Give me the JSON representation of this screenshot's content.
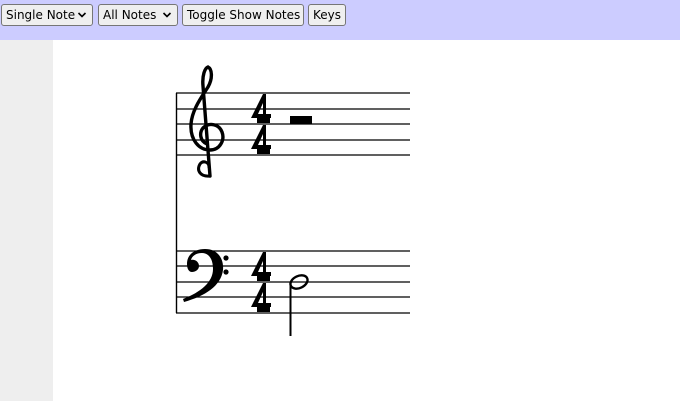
{
  "toolbar": {
    "mode_select": {
      "value": "Single Note"
    },
    "notes_select": {
      "value": "All Notes"
    },
    "toggle_show_notes_label": "Toggle Show Notes",
    "keys_label": "Keys"
  },
  "colors": {
    "toolbar_bg": "#ccccff",
    "sidebar_bg": "#eeeeee",
    "ink": "#000000"
  },
  "score": {
    "treble": {
      "clef": "treble-clef-icon",
      "time_signature": [
        "4",
        "4"
      ],
      "content": "whole-rest-icon"
    },
    "bass": {
      "clef": "bass-clef-icon",
      "time_signature": [
        "4",
        "4"
      ],
      "content": "half-note-icon"
    }
  }
}
